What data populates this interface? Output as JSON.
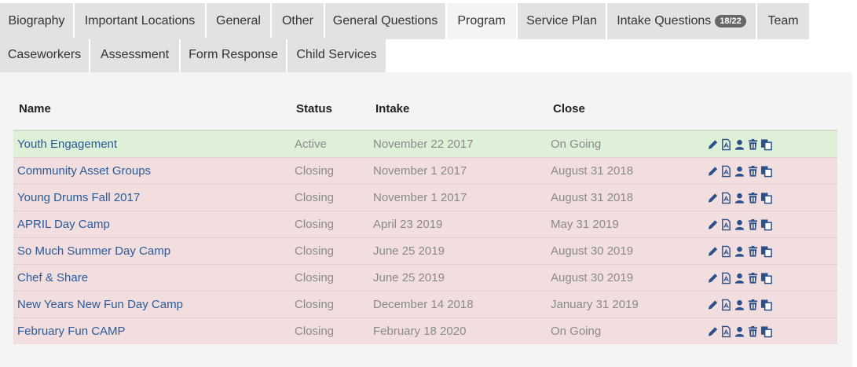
{
  "tabs": [
    {
      "label": "Biography"
    },
    {
      "label": "Important Locations"
    },
    {
      "label": "General"
    },
    {
      "label": "Other"
    },
    {
      "label": "General Questions"
    },
    {
      "label": "Program"
    },
    {
      "label": "Service Plan"
    },
    {
      "label": "Intake Questions",
      "badge": "18/22"
    },
    {
      "label": "Team"
    },
    {
      "label": "Caseworkers"
    },
    {
      "label": "Assessment"
    },
    {
      "label": "Form Response"
    },
    {
      "label": "Child Services"
    }
  ],
  "active_tab": "Program",
  "table": {
    "headers": {
      "name": "Name",
      "status": "Status",
      "intake": "Intake",
      "close": "Close"
    },
    "rows": [
      {
        "name": "Youth Engagement",
        "status": "Active",
        "intake": "November 22 2017",
        "close": "On Going"
      },
      {
        "name": "Community Asset Groups",
        "status": "Closing",
        "intake": "November 1 2017",
        "close": "August 31 2018"
      },
      {
        "name": "Young Drums Fall 2017",
        "status": "Closing",
        "intake": "November 1 2017",
        "close": "August 31 2018"
      },
      {
        "name": "APRIL Day Camp",
        "status": "Closing",
        "intake": "April 23 2019",
        "close": "May 31 2019"
      },
      {
        "name": "So Much Summer Day Camp",
        "status": "Closing",
        "intake": "June 25 2019",
        "close": "August 30 2019"
      },
      {
        "name": "Chef & Share",
        "status": "Closing",
        "intake": "June 25 2019",
        "close": "August 30 2019"
      },
      {
        "name": "New Years New Fun Day Camp",
        "status": "Closing",
        "intake": "December 14 2018",
        "close": "January 31 2019"
      },
      {
        "name": "February Fun CAMP",
        "status": "Closing",
        "intake": "February 18 2020",
        "close": "On Going"
      }
    ],
    "row_actions": [
      "edit-icon",
      "pdf-icon",
      "user-icon",
      "trash-icon",
      "copy-icon"
    ]
  },
  "colors": {
    "active_row": "#dff0d8",
    "closing_row": "#f2dede",
    "link": "#2a5a98",
    "icon": "#2a4f8a"
  }
}
